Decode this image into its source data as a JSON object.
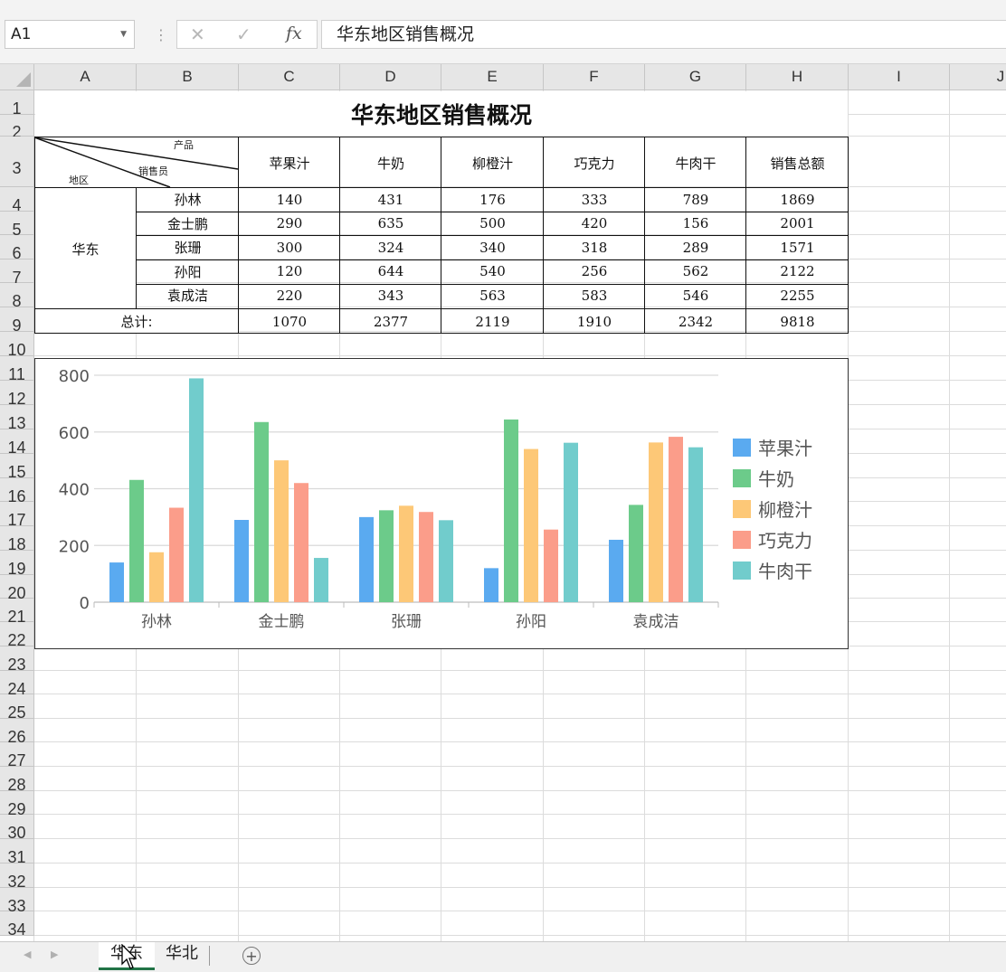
{
  "formula_bar": {
    "name_box": "A1",
    "cancel_glyph": "✕",
    "enter_glyph": "✓",
    "fx_label": "fx",
    "formula": "华东地区销售概况"
  },
  "column_headers": [
    "A",
    "B",
    "C",
    "D",
    "E",
    "F",
    "G",
    "H",
    "I",
    "J"
  ],
  "row_headers": [
    "1",
    "2",
    "3",
    "4",
    "5",
    "6",
    "7",
    "8",
    "9",
    "10",
    "11",
    "12",
    "13",
    "14",
    "15",
    "16",
    "17",
    "18",
    "19",
    "20",
    "21",
    "22",
    "23",
    "24",
    "25",
    "26",
    "27",
    "28",
    "29",
    "30",
    "31",
    "32",
    "33",
    "34"
  ],
  "table": {
    "title": "华东地区销售概况",
    "corner_labels": {
      "product": "产品",
      "salesperson": "销售员",
      "region": "地区"
    },
    "products": [
      "苹果汁",
      "牛奶",
      "柳橙汁",
      "巧克力",
      "牛肉干"
    ],
    "total_header": "销售总额",
    "region": "华东",
    "rows": [
      {
        "name": "孙林",
        "values": [
          "140",
          "431",
          "176",
          "333",
          "789"
        ],
        "total": "1869"
      },
      {
        "name": "金士鹏",
        "values": [
          "290",
          "635",
          "500",
          "420",
          "156"
        ],
        "total": "2001"
      },
      {
        "name": "张珊",
        "values": [
          "300",
          "324",
          "340",
          "318",
          "289"
        ],
        "total": "1571"
      },
      {
        "name": "孙阳",
        "values": [
          "120",
          "644",
          "540",
          "256",
          "562"
        ],
        "total": "2122"
      },
      {
        "name": "袁成洁",
        "values": [
          "220",
          "343",
          "563",
          "583",
          "546"
        ],
        "total": "2255"
      }
    ],
    "sum_label": "总计:",
    "sum_values": [
      "1070",
      "2377",
      "2119",
      "1910",
      "2342"
    ],
    "sum_total": "9818"
  },
  "chart_data": {
    "type": "bar",
    "categories": [
      "孙林",
      "金士鹏",
      "张珊",
      "孙阳",
      "袁成洁"
    ],
    "series": [
      {
        "name": "苹果汁",
        "values": [
          140,
          290,
          300,
          120,
          220
        ],
        "color": "#5aaaf0"
      },
      {
        "name": "牛奶",
        "values": [
          431,
          635,
          324,
          644,
          343
        ],
        "color": "#6ccb8a"
      },
      {
        "name": "柳橙汁",
        "values": [
          176,
          500,
          340,
          540,
          563
        ],
        "color": "#fdc877"
      },
      {
        "name": "巧克力",
        "values": [
          333,
          420,
          318,
          256,
          583
        ],
        "color": "#fb9d8a"
      },
      {
        "name": "牛肉干",
        "values": [
          789,
          156,
          289,
          562,
          546
        ],
        "color": "#71cccc"
      }
    ],
    "yticks": [
      "0",
      "200",
      "400",
      "600",
      "800"
    ],
    "ylim": [
      0,
      800
    ],
    "title": "",
    "xlabel": "",
    "ylabel": "",
    "grid": true,
    "legend": "right"
  },
  "sheet_tabs": [
    {
      "label": "华东",
      "active": true
    },
    {
      "label": "华北",
      "active": false
    }
  ],
  "add_sheet_glyph": "+",
  "colors": {
    "tab_active_underline": "#217346",
    "header_bg": "#e6e6e6"
  }
}
